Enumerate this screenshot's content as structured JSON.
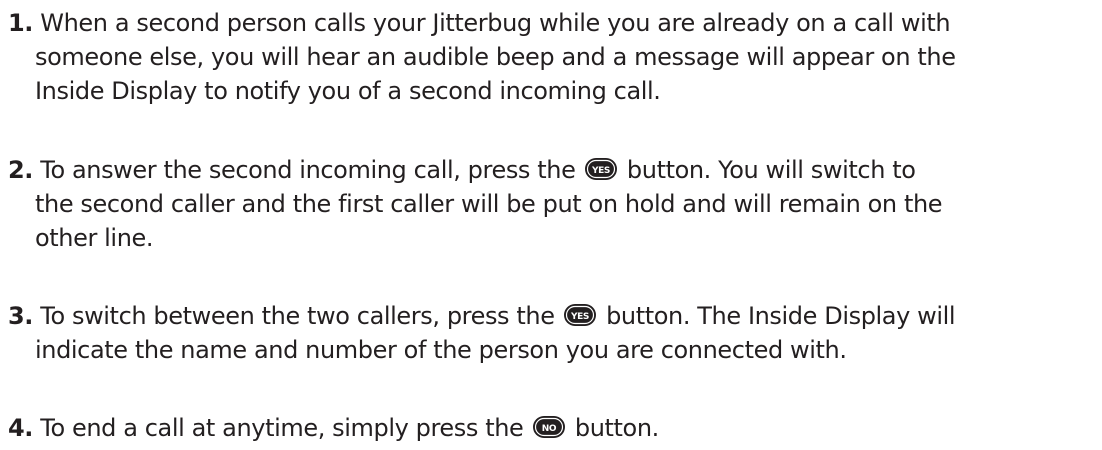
{
  "steps": [
    {
      "number": "1.",
      "lines": [
        "When a second person calls your Jitterbug while you are already on a call with",
        "someone else, you will hear an audible beep and a message will appear on the",
        "Inside Display to notify you of a second incoming call."
      ]
    },
    {
      "number": "2.",
      "lines": [
        "To answer the second incoming call, press the",
        "button. You will switch to",
        "the second caller and the first caller will be put on hold and will remain on the",
        "other line."
      ],
      "key_label": "YES"
    },
    {
      "number": "3.",
      "lines": [
        "To switch between the two callers, press the",
        "button. The Inside Display will",
        "indicate the name and number of the person you are connected with."
      ],
      "key_label": "YES"
    },
    {
      "number": "4.",
      "lines": [
        "To end a call at anytime, simply press the",
        "button."
      ],
      "key_label": "NO"
    }
  ],
  "icons": {
    "yes_key": "yes-key-icon",
    "no_key": "no-key-icon"
  },
  "colors": {
    "text": "#231f20",
    "key_fill": "#231f20",
    "key_text": "#ffffff"
  }
}
